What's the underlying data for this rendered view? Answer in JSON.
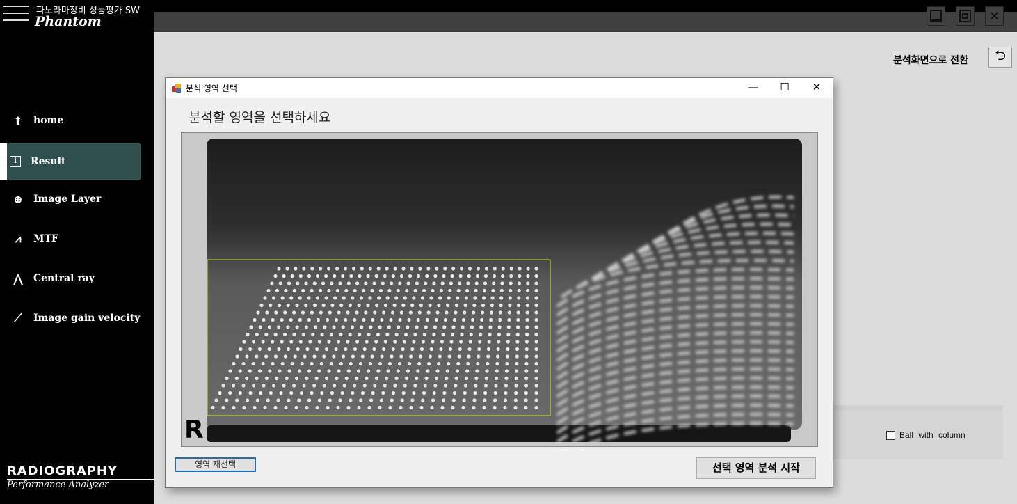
{
  "app": {
    "title": "파노라마장비 성능평가 SW",
    "logo": "Phantom",
    "brand_line1": "RADIOGRAPHY",
    "brand_line2": "Performance Analyzer"
  },
  "sidebar": {
    "items": [
      {
        "label": "home",
        "icon": "home-icon"
      },
      {
        "label": "Result",
        "icon": "info-icon",
        "active": true
      },
      {
        "label": "Image Layer",
        "icon": "crosshair-icon"
      },
      {
        "label": "MTF",
        "icon": "waveform-icon"
      },
      {
        "label": "Central ray",
        "icon": "ray-icon"
      },
      {
        "label": "Image gain velocity",
        "icon": "probe-icon"
      }
    ]
  },
  "window_controls": {
    "minimize": "minimize-icon",
    "restore": "restore-icon",
    "close": "close-icon"
  },
  "main": {
    "switch_label": "분석화면으로 전환",
    "switch_icon": "return-arrow-icon",
    "checkbox_label": "Ball  with  column",
    "checkbox_checked": false
  },
  "dialog": {
    "title": "분석 영역 선택",
    "prompt": "분석할 영역을 선택하세요",
    "reselect_label": "영역 재선택",
    "start_label": "선택 영역 분석 시작",
    "image_marker": "R",
    "selection_color": "#c8e640"
  }
}
